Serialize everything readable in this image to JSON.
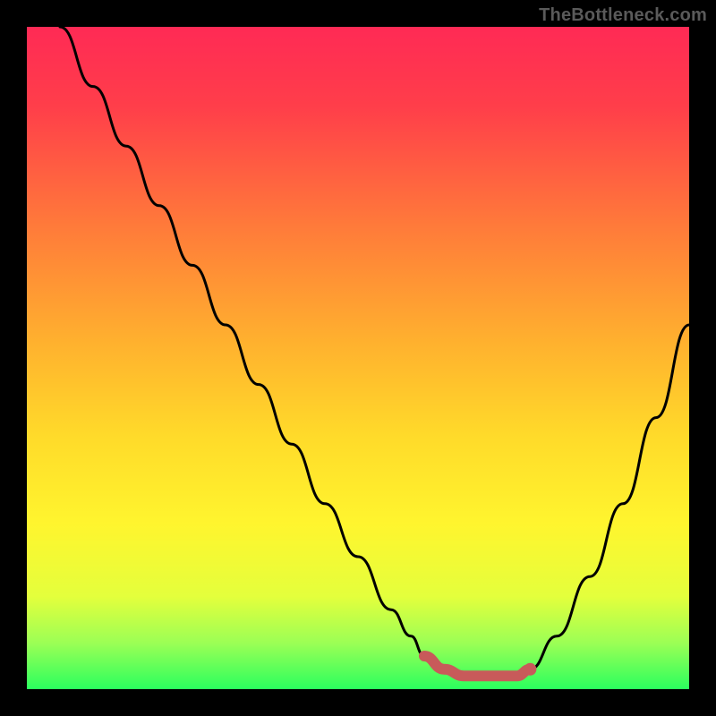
{
  "watermark": "TheBottleneck.com",
  "colors": {
    "gradient_stops": [
      {
        "offset": 0.0,
        "color": "#ff2a55"
      },
      {
        "offset": 0.12,
        "color": "#ff3e4a"
      },
      {
        "offset": 0.3,
        "color": "#ff7a3a"
      },
      {
        "offset": 0.48,
        "color": "#ffb22e"
      },
      {
        "offset": 0.62,
        "color": "#ffdb2a"
      },
      {
        "offset": 0.75,
        "color": "#fff52e"
      },
      {
        "offset": 0.86,
        "color": "#e4ff3c"
      },
      {
        "offset": 0.93,
        "color": "#9cff55"
      },
      {
        "offset": 1.0,
        "color": "#2bff5e"
      }
    ],
    "curve": "#000000",
    "marker_stroke": "#c85a5a",
    "marker_fill": "#c85a5a"
  },
  "chart_data": {
    "type": "line",
    "title": "",
    "xlabel": "",
    "ylabel": "",
    "xlim": [
      0,
      100
    ],
    "ylim": [
      0,
      100
    ],
    "grid": false,
    "legend": false,
    "series": [
      {
        "name": "bottleneck-curve",
        "x": [
          5,
          10,
          15,
          20,
          25,
          30,
          35,
          40,
          45,
          50,
          55,
          58,
          60,
          63,
          66,
          70,
          74,
          76,
          80,
          85,
          90,
          95,
          100
        ],
        "y": [
          100,
          91,
          82,
          73,
          64,
          55,
          46,
          37,
          28,
          20,
          12,
          8,
          5,
          3,
          2,
          2,
          2,
          3,
          8,
          17,
          28,
          41,
          55
        ]
      }
    ],
    "annotations": [
      {
        "name": "optimal-region",
        "kind": "highlight-segment",
        "x_range": [
          60,
          76
        ],
        "y_approx": 2
      },
      {
        "name": "optimal-point",
        "kind": "marker",
        "x": 76,
        "y": 3
      }
    ]
  }
}
